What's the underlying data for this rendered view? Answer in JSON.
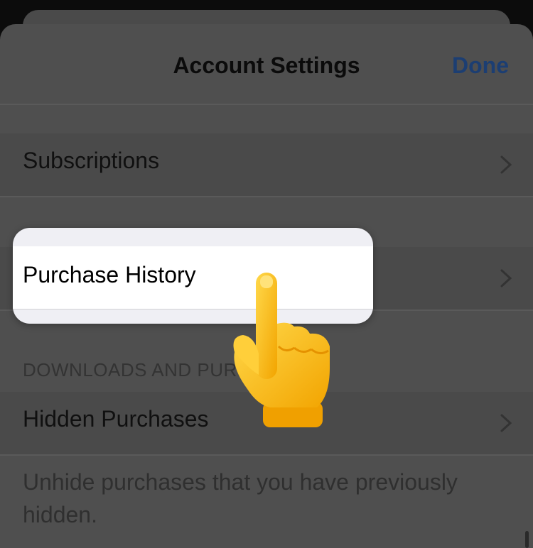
{
  "nav": {
    "title": "Account Settings",
    "done_label": "Done"
  },
  "rows": {
    "subscriptions": "Subscriptions",
    "purchase_history": "Purchase History",
    "hidden_purchases": "Hidden Purchases"
  },
  "section": {
    "downloads_header": "DOWNLOADS AND PURCHASES"
  },
  "footnote": "Unhide purchases that you have previously hidden.",
  "icons": {
    "chevron": "chevron-right-icon",
    "pointer": "pointing-hand-icon"
  },
  "colors": {
    "accent": "#1c3e72",
    "highlight": "#ffffff"
  }
}
